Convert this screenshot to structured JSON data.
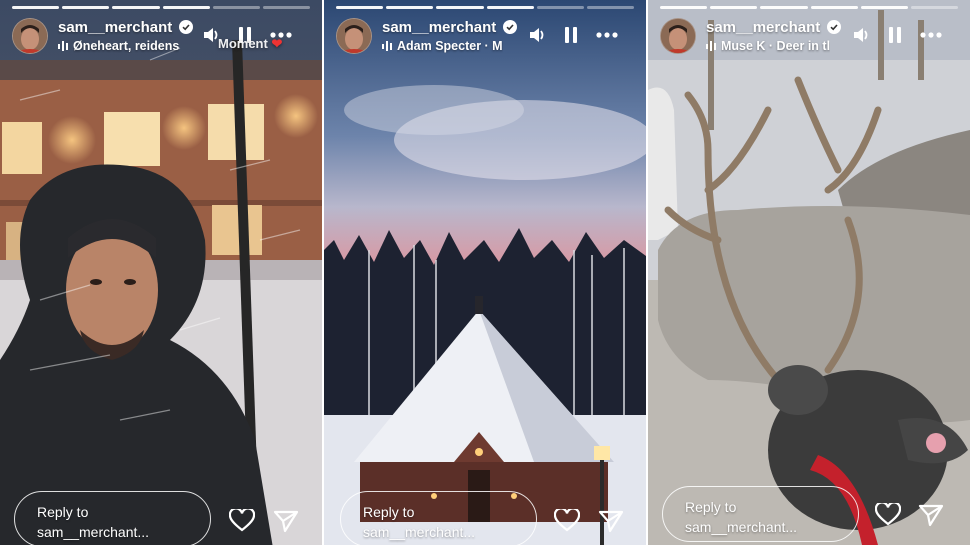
{
  "stories": [
    {
      "username": "sam__merchant",
      "music": "Øneheart, reidens",
      "overlay_text": "Moment",
      "reply_line1": "Reply to",
      "reply_line2": "sam__merchant..."
    },
    {
      "username": "sam__merchant",
      "music": "Adam Specter · M",
      "reply_line1": "Reply to",
      "reply_line2": "sam__merchant..."
    },
    {
      "username": "sam__merchant",
      "music": "Muse K · Deer in tl",
      "reply_line1": "Reply to",
      "reply_line2": "sam__merchant..."
    }
  ],
  "icons": {
    "verified": "verified-badge-icon",
    "music": "music-bars-icon",
    "sound": "speaker-icon",
    "pause": "pause-icon",
    "more": "more-dots-icon",
    "like": "heart-icon",
    "share": "send-icon"
  },
  "colors": {
    "verified": "#ffffff",
    "progress": "#ffffff"
  }
}
